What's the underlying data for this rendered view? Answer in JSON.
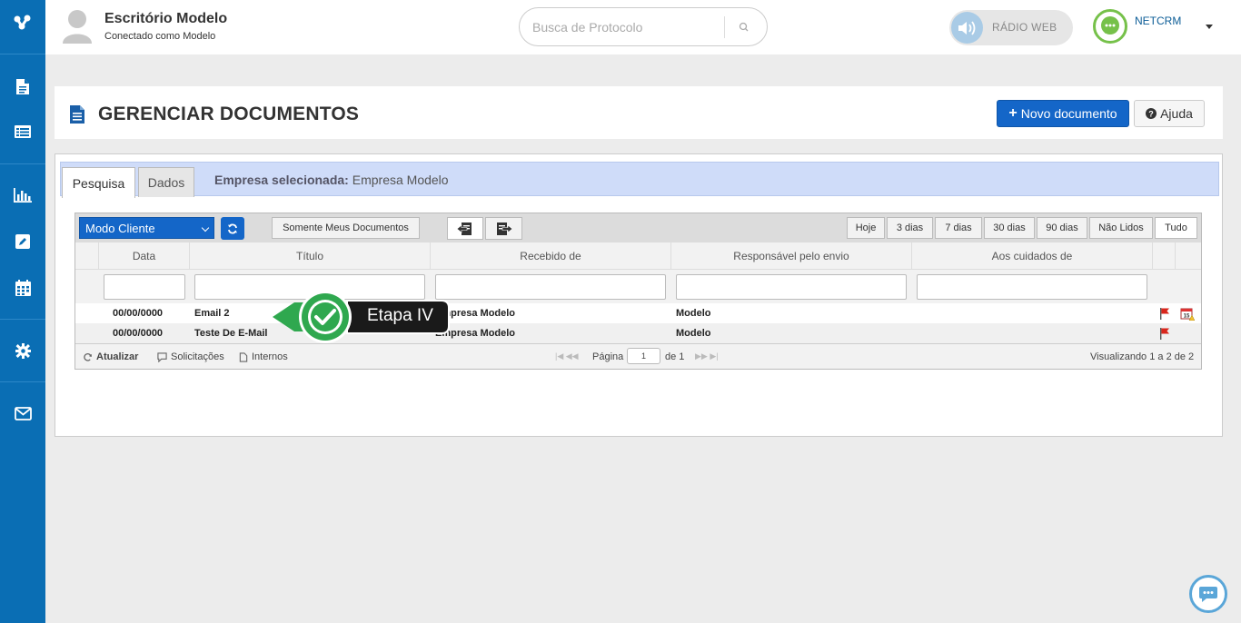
{
  "header": {
    "office_title": "Escritório Modelo",
    "connected_as": "Conectado como Modelo",
    "search_placeholder": "Busca de Protocolo",
    "radio_label": "RÁDIO WEB",
    "brand": "NETCRM"
  },
  "page": {
    "title": "GERENCIAR DOCUMENTOS",
    "new_button": "Novo documento",
    "help_button": "Ajuda"
  },
  "tabs": {
    "search": "Pesquisa",
    "data": "Dados",
    "company_label": "Empresa selecionada:",
    "company_value": "Empresa Modelo"
  },
  "toolbar": {
    "mode_select": "Modo Cliente",
    "my_docs_button": "Somente Meus Documentos",
    "periods": [
      "Hoje",
      "3 dias",
      "7 dias",
      "30 dias",
      "90 dias",
      "Não Lidos",
      "Tudo"
    ],
    "active_period": "Tudo"
  },
  "table": {
    "columns": [
      "Data",
      "Título",
      "Recebido de",
      "Responsável pelo envio",
      "Aos cuidados de"
    ],
    "rows": [
      {
        "data": "00/00/0000",
        "titulo": "Email 2",
        "recebido": "Empresa Modelo",
        "responsavel": "Modelo",
        "cuidados": ""
      },
      {
        "data": "00/00/0000",
        "titulo": "Teste De E-Mail",
        "recebido": "Empresa Modelo",
        "responsavel": "Modelo",
        "cuidados": ""
      }
    ]
  },
  "footer": {
    "refresh": "Atualizar",
    "requests": "Solicitações",
    "internal": "Internos",
    "page_label": "Página",
    "page_value": "1",
    "of_label": "de 1",
    "viewing": "Visualizando 1 a 2 de 2"
  },
  "callout": {
    "text": "Etapa IV"
  },
  "colors": {
    "sidebar": "#0a6eb4",
    "primary": "#1466c8",
    "tabbar": "#cfdcf9",
    "callout_green": "#2fa84f"
  }
}
